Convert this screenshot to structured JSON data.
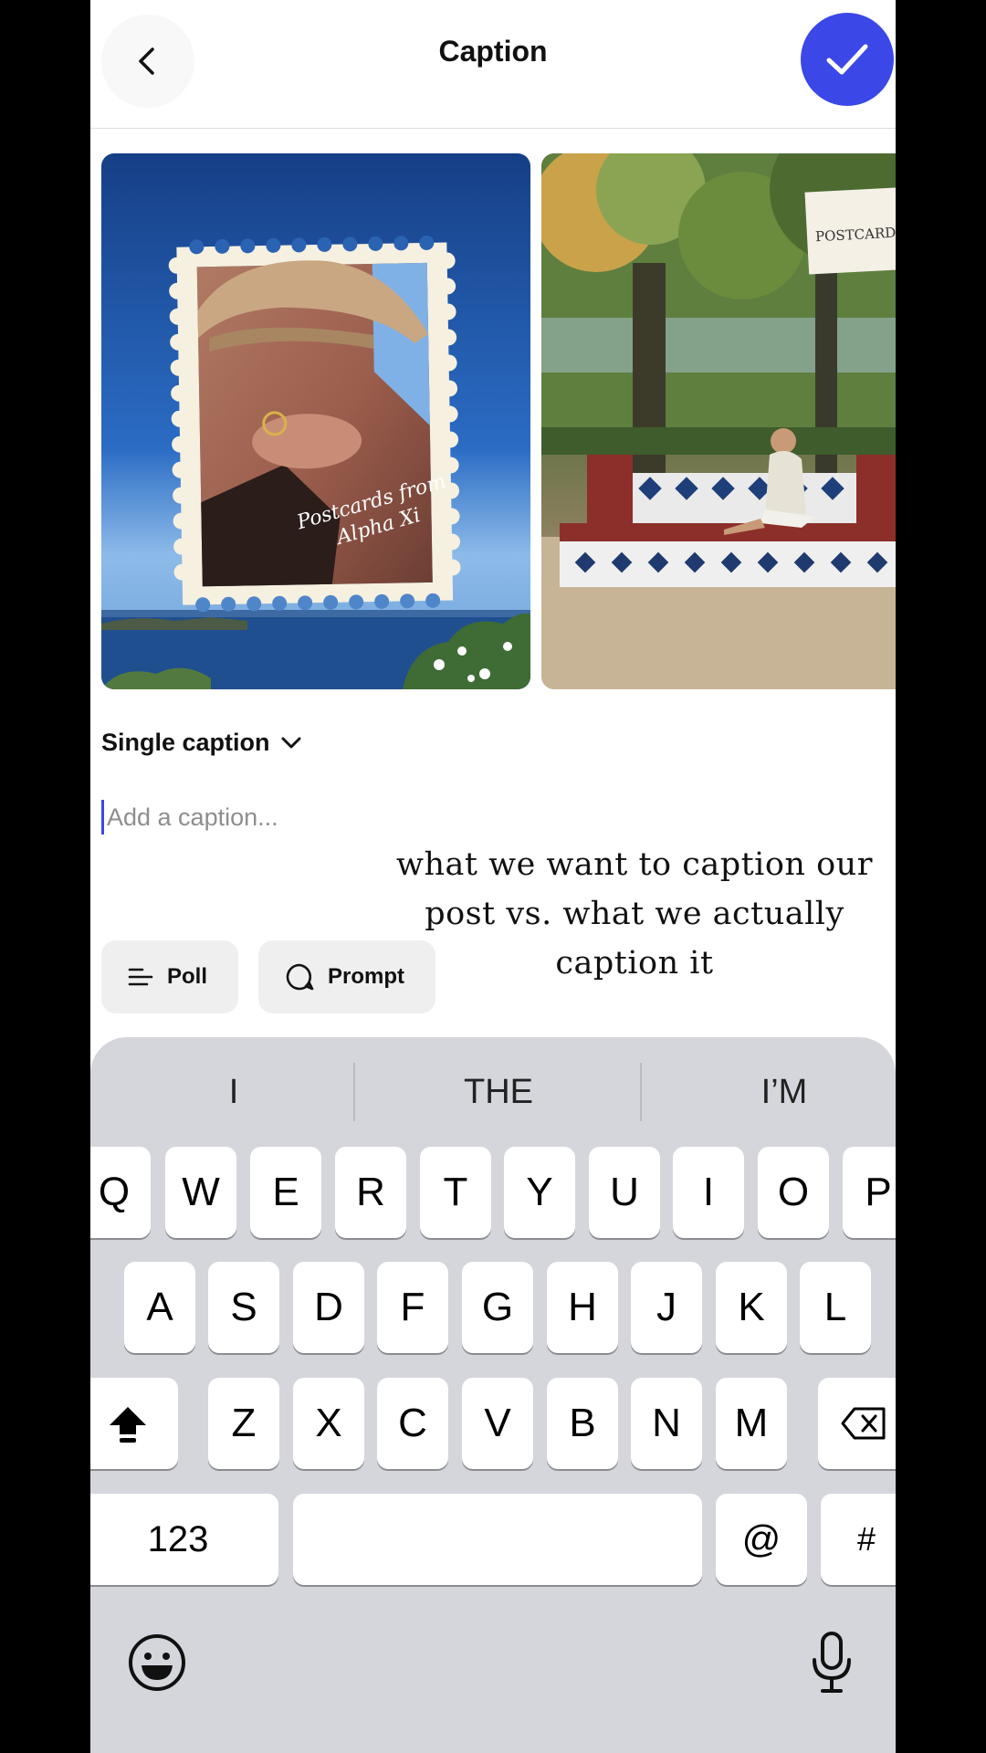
{
  "header": {
    "title": "Caption",
    "back_icon": "chevron-left-icon",
    "confirm_icon": "checkmark-icon",
    "accent_color": "#3b47e6"
  },
  "photos": [
    {
      "stamp_text_line1": "Postcards from",
      "stamp_text_line2": "Alpha Xi"
    },
    {
      "postcard_label": "POSTCARD"
    }
  ],
  "caption": {
    "mode_label": "Single caption",
    "placeholder": "Add a caption...",
    "overlay_text": "what we want to caption our post vs. what we actually caption it"
  },
  "chips": {
    "poll_label": "Poll",
    "prompt_label": "Prompt"
  },
  "keyboard": {
    "suggestions": [
      "I",
      "THE",
      "I’M"
    ],
    "row1": [
      "Q",
      "W",
      "E",
      "R",
      "T",
      "Y",
      "U",
      "I",
      "O",
      "P"
    ],
    "row2": [
      "A",
      "S",
      "D",
      "F",
      "G",
      "H",
      "J",
      "K",
      "L"
    ],
    "row3": [
      "Z",
      "X",
      "C",
      "V",
      "B",
      "N",
      "M"
    ],
    "numbers_label": "123",
    "at_label": "@",
    "hash_label": "#"
  }
}
